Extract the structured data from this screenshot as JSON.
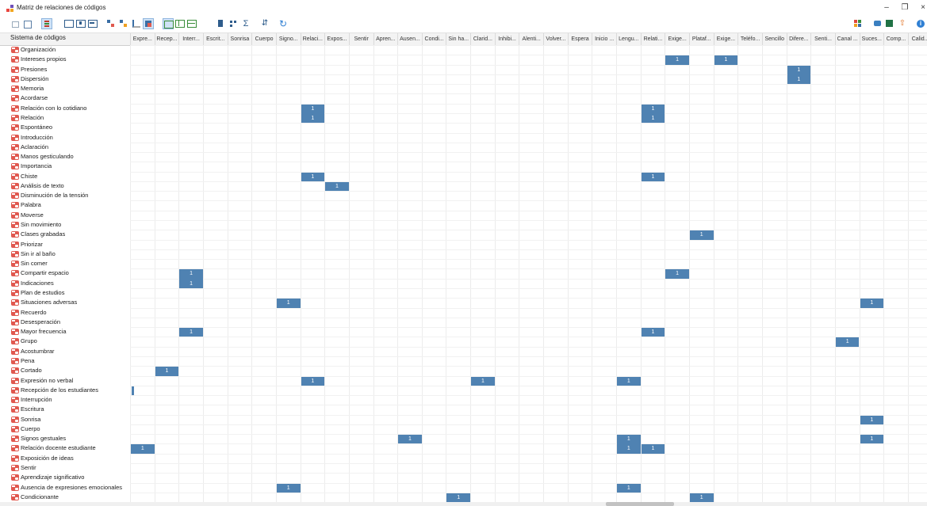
{
  "window": {
    "title": "Matriz de relaciones de códigos",
    "minimize_icon": "minimize-icon",
    "restore_icon": "restore-icon",
    "close_icon": "close-icon"
  },
  "tree_header": "Sistema de códigos",
  "columns": [
    "Expre...",
    "Recep...",
    "Interr...",
    "Escrit...",
    "Sonrisa",
    "Cuerpo",
    "Signo...",
    "Relaci...",
    "Expos...",
    "Sentir",
    "Apren...",
    "Ausen...",
    "Condi...",
    "Sin ha...",
    "Clarid...",
    "Inhibi...",
    "Alenti...",
    "Volver...",
    "Espera",
    "Inicio ...",
    "Lengu...",
    "Relati...",
    "Exige...",
    "Plataf...",
    "Exige...",
    "Teléfo...",
    "Sencillo",
    "Difere...",
    "Senti...",
    "Canal ...",
    "Suces...",
    "Comp...",
    "Calid..."
  ],
  "rows": [
    "Organización",
    "Intereses propios",
    "Presiones",
    "Dispersión",
    "Memoria",
    "Acordarse",
    "Relación con lo cotidiano",
    "Relación",
    "Espontáneo",
    "Introducción",
    "Aclaración",
    "Manos gesticulando",
    "Importancia",
    "Chiste",
    "Análisis de texto",
    "Disminución de la tensión",
    "Palabra",
    "Moverse",
    "Sin movimiento",
    "Clases grabadas",
    "Priorizar",
    "Sin ir al baño",
    "Sin comer",
    "Compartir espacio",
    "Indicaciones",
    "Plan de estudios",
    "Situaciones adversas",
    "Recuerdo",
    "Desesperación",
    "Mayor frecuencia",
    "Grupo",
    "Acostumbrar",
    "Pena",
    "Cortado",
    "Expresión no verbal",
    "Recepción de los estudiantes",
    "Interrupción",
    "Escritura",
    "Sonrisa",
    "Cuerpo",
    "Signos gestuales",
    "Relación docente estudiante",
    "Exposición de ideas",
    "Sentir",
    "Aprendizaje significativo",
    "Ausencia de expresiones emocionales",
    "Condicionante"
  ],
  "cells": [
    {
      "row": 1,
      "col": 22,
      "value": "1"
    },
    {
      "row": 1,
      "col": 24,
      "value": "1"
    },
    {
      "row": 2,
      "col": 27,
      "value": "1"
    },
    {
      "row": 3,
      "col": 27,
      "value": "1"
    },
    {
      "row": 6,
      "col": 7,
      "value": "1"
    },
    {
      "row": 6,
      "col": 21,
      "value": "1"
    },
    {
      "row": 7,
      "col": 7,
      "value": "1"
    },
    {
      "row": 7,
      "col": 21,
      "value": "1"
    },
    {
      "row": 13,
      "col": 7,
      "value": "1"
    },
    {
      "row": 13,
      "col": 21,
      "value": "1"
    },
    {
      "row": 14,
      "col": 8,
      "value": "1"
    },
    {
      "row": 19,
      "col": 23,
      "value": "1"
    },
    {
      "row": 23,
      "col": 2,
      "value": "1"
    },
    {
      "row": 23,
      "col": 22,
      "value": "1"
    },
    {
      "row": 24,
      "col": 2,
      "value": "1"
    },
    {
      "row": 26,
      "col": 6,
      "value": "1"
    },
    {
      "row": 26,
      "col": 30,
      "value": "1"
    },
    {
      "row": 29,
      "col": 2,
      "value": "1"
    },
    {
      "row": 29,
      "col": 21,
      "value": "1"
    },
    {
      "row": 30,
      "col": 29,
      "value": "1"
    },
    {
      "row": 33,
      "col": 1,
      "value": "1"
    },
    {
      "row": 34,
      "col": 7,
      "value": "1"
    },
    {
      "row": 34,
      "col": 14,
      "value": "1"
    },
    {
      "row": 34,
      "col": 20,
      "value": "1"
    },
    {
      "row": 38,
      "col": 30,
      "value": "1"
    },
    {
      "row": 40,
      "col": 11,
      "value": "1"
    },
    {
      "row": 40,
      "col": 20,
      "value": "1"
    },
    {
      "row": 40,
      "col": 30,
      "value": "1"
    },
    {
      "row": 41,
      "col": 0,
      "value": "1"
    },
    {
      "row": 41,
      "col": 20,
      "value": "1"
    },
    {
      "row": 41,
      "col": 21,
      "value": "1"
    },
    {
      "row": 45,
      "col": 6,
      "value": "1"
    },
    {
      "row": 45,
      "col": 20,
      "value": "1"
    },
    {
      "row": 46,
      "col": 13,
      "value": "1"
    },
    {
      "row": 46,
      "col": 23,
      "value": "1"
    }
  ],
  "code_icon_color": "#e0584f",
  "cell_color": "#4f82b2"
}
